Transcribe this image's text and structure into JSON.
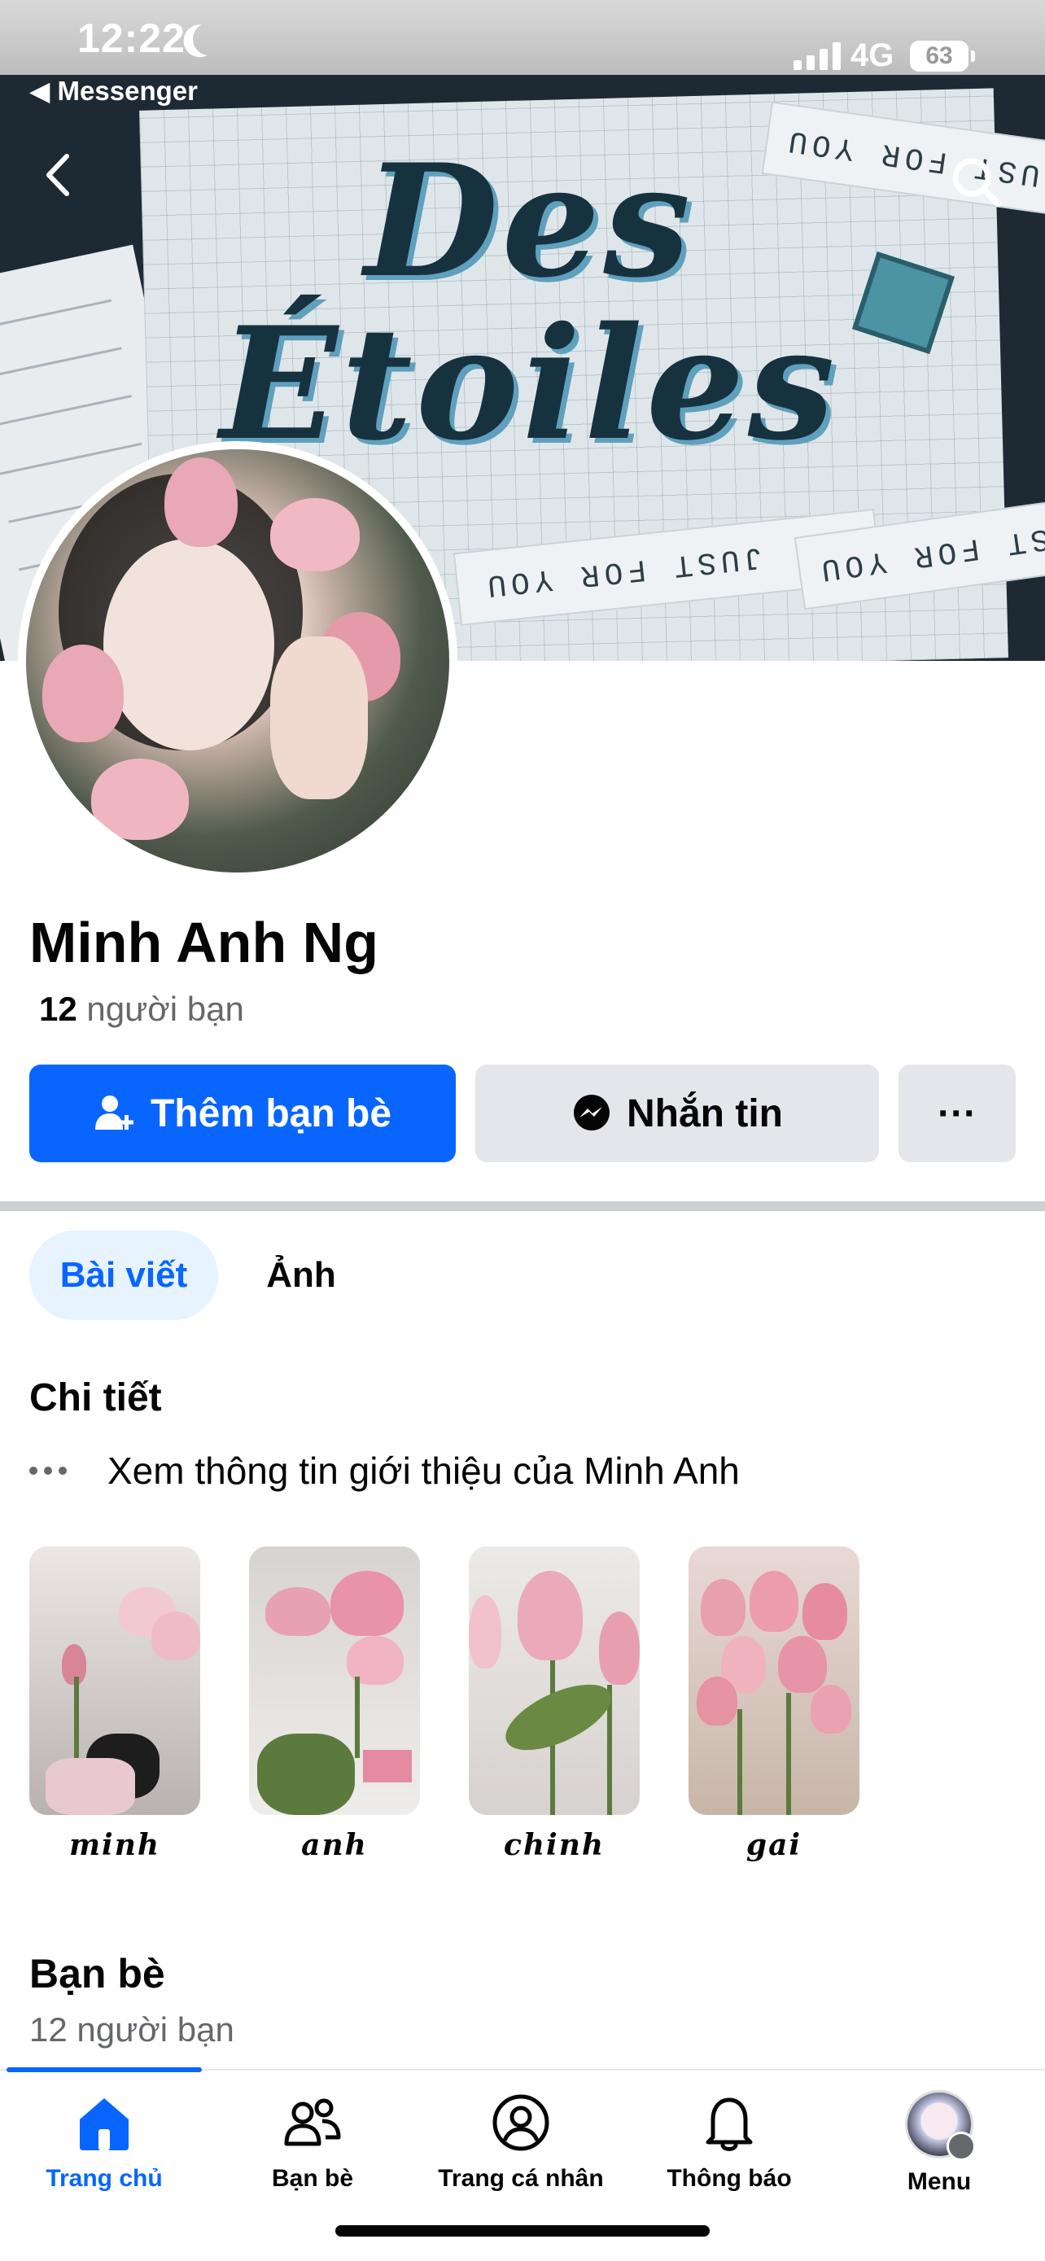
{
  "status_bar": {
    "time": "12:22",
    "network": "4G",
    "battery": "63"
  },
  "header": {
    "back_app": "◀ Messenger"
  },
  "cover": {
    "title_line1": "Des",
    "title_line2": "Étoiles",
    "ribbon_text": "JUST FOR YOU"
  },
  "profile": {
    "name": "Minh Anh Ng",
    "friend_count": "12",
    "friend_count_suffix": "người bạn"
  },
  "actions": {
    "add_friend_label": "Thêm bạn bè",
    "message_label": "Nhắn tin",
    "more_label": "···"
  },
  "tabs": [
    {
      "label": "Bài viết",
      "active": true
    },
    {
      "label": "Ảnh",
      "active": false
    }
  ],
  "details": {
    "title": "Chi tiết",
    "intro_text": "Xem thông tin giới thiệu của Minh Anh"
  },
  "highlights": [
    {
      "label": "minh"
    },
    {
      "label": "anh"
    },
    {
      "label": "chinh"
    },
    {
      "label": "gai"
    }
  ],
  "friends": {
    "title": "Bạn bè",
    "subtitle": "12 người bạn"
  },
  "bottom_nav": [
    {
      "label": "Trang chủ",
      "icon": "home-icon",
      "active": true
    },
    {
      "label": "Bạn bè",
      "icon": "friends-icon",
      "active": false
    },
    {
      "label": "Trang cá nhân",
      "icon": "profile-icon",
      "active": false
    },
    {
      "label": "Thông báo",
      "icon": "bell-icon",
      "active": false
    },
    {
      "label": "Menu",
      "icon": "menu-avatar",
      "active": false
    }
  ],
  "colors": {
    "primary": "#0866ff",
    "secondary_button": "#e4e6eb",
    "muted_text": "#65676b",
    "tab_active_bg": "#e7f3ff"
  }
}
